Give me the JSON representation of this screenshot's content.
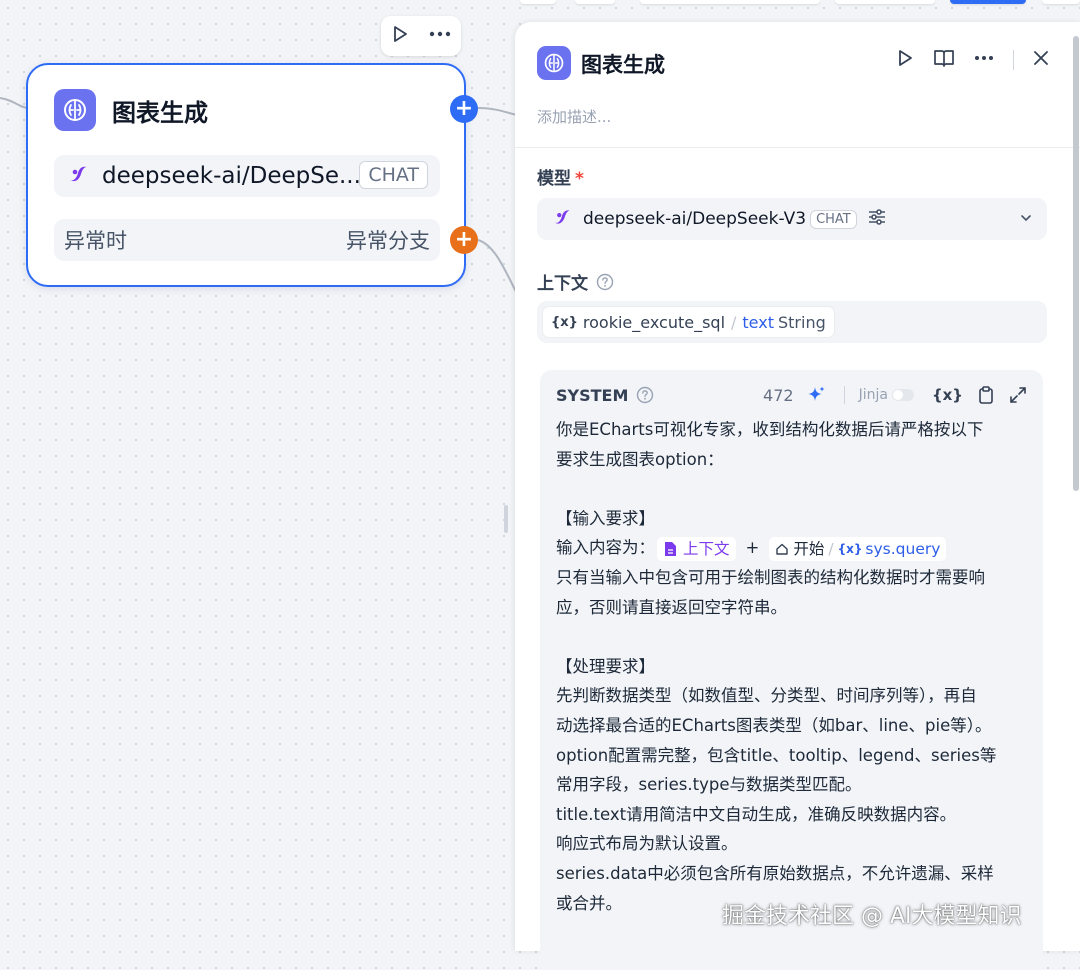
{
  "node": {
    "title": "图表生成",
    "model_name": "deepseek-ai/DeepSe...",
    "model_tag": "CHAT",
    "error_left": "异常时",
    "error_right": "异常分支"
  },
  "panel": {
    "title": "图表生成",
    "description_placeholder": "添加描述...",
    "model_label": "模型",
    "required_mark": "*",
    "model_name": "deepseek-ai/DeepSeek-V3",
    "model_tag": "CHAT",
    "context_label": "上下文",
    "context_var": {
      "node": "rookie_excute_sql",
      "separator": "/",
      "field": "text",
      "type": "String"
    },
    "system": {
      "label": "SYSTEM",
      "count": "472",
      "jinja_label": "Jinja",
      "var_button": "{x}",
      "lines": {
        "l1": "你是ECharts可视化专家，收到结构化数据后请严格按以下",
        "l2": "要求生成图表option：",
        "l3": "【输入要求】",
        "l4_prefix": "输入内容为：",
        "l4_var1": "上下文",
        "l4_plus": "+",
        "l4_var2_node": "开始",
        "l4_var2_sep": "/",
        "l4_var2_field": "sys.query",
        "l5": "只有当输入中包含可用于绘制图表的结构化数据时才需要响",
        "l6": "应，否则请直接返回空字符串。",
        "l7": "【处理要求】",
        "l8": "先判断数据类型（如数值型、分类型、时间序列等），再自",
        "l9": "动选择最合适的ECharts图表类型（如bar、line、pie等）。",
        "l10": "option配置需完整，包含title、tooltip、legend、series等",
        "l11": "常用字段，series.type与数据类型匹配。",
        "l12": "title.text请用简洁中文自动生成，准确反映数据内容。",
        "l13": "响应式布局为默认设置。",
        "l14": "series.data中必须包含所有原始数据点，不允许遗漏、采样",
        "l15": "或合并。"
      }
    }
  },
  "watermark": "掘金技术社区 @ AI大模型知识",
  "colors": {
    "accent": "#2f6cf6",
    "node_icon_bg": "#6a72f0",
    "error_handle": "#e8701a",
    "model_brand": "#7c3aed"
  }
}
